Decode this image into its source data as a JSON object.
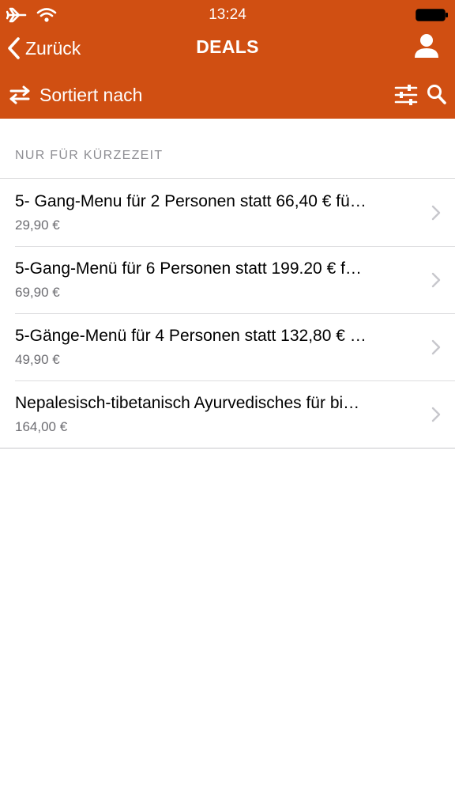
{
  "status_bar": {
    "time": "13:24",
    "icons": [
      "airplane-icon",
      "wifi-icon",
      "battery-icon"
    ]
  },
  "nav": {
    "back_label": "Zurück",
    "title": "DEALS",
    "icons": [
      "chevron-left-icon",
      "profile-icon"
    ]
  },
  "toolbar": {
    "sort_label": "Sortiert nach",
    "icons": [
      "swap-arrows-icon",
      "filter-sliders-icon",
      "search-icon"
    ]
  },
  "section": {
    "header": "NUR FÜR KÜRZEZEIT"
  },
  "deals": [
    {
      "title": "5- Gang-Menu für 2 Personen statt 66,40 € fü…",
      "price": "29,90 €"
    },
    {
      "title": "5-Gang-Menü für 6 Personen statt 199.20 € f…",
      "price": "69,90 €"
    },
    {
      "title": "5-Gänge-Menü für 4 Personen statt 132,80 € …",
      "price": "49,90 €"
    },
    {
      "title": "Nepalesisch-tibetanisch Ayurvedisches für bi…",
      "price": "164,00 €"
    }
  ],
  "colors": {
    "brand": "#d04f12",
    "header_text": "#ffffff",
    "section_text": "#8e8e93",
    "price_text": "#6d6d72",
    "separator": "#dcdcde",
    "chevron": "#c7c7cc"
  }
}
